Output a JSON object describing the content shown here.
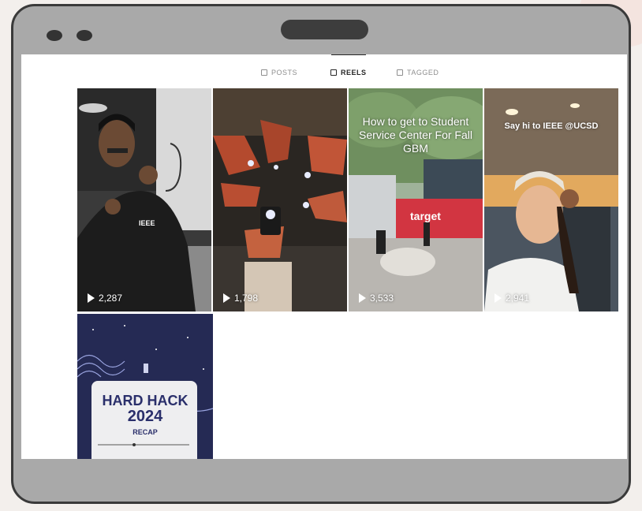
{
  "tabs": [
    {
      "label": "POSTS",
      "active": false
    },
    {
      "label": "REELS",
      "active": true
    },
    {
      "label": "TAGGED",
      "active": false
    }
  ],
  "reels": [
    {
      "views": "2,287",
      "caption": ""
    },
    {
      "views": "1,798",
      "caption": ""
    },
    {
      "views": "3,533",
      "caption": "How to get to Student Service Center For Fall GBM"
    },
    {
      "views": "2,941",
      "caption": "Say hi to IEEE @UCSD"
    },
    {
      "views": "",
      "caption": ""
    }
  ],
  "reel_text": {
    "shirt_logo": "IEEE",
    "store_sign": "target",
    "hardhack_title_1": "HARD HACK",
    "hardhack_title_2": "2024",
    "hardhack_sub": "RECAP"
  },
  "colors": {
    "device_frame": "#a9a9a9",
    "active_tab": "#262626",
    "inactive_tab": "#8e8e8e"
  }
}
